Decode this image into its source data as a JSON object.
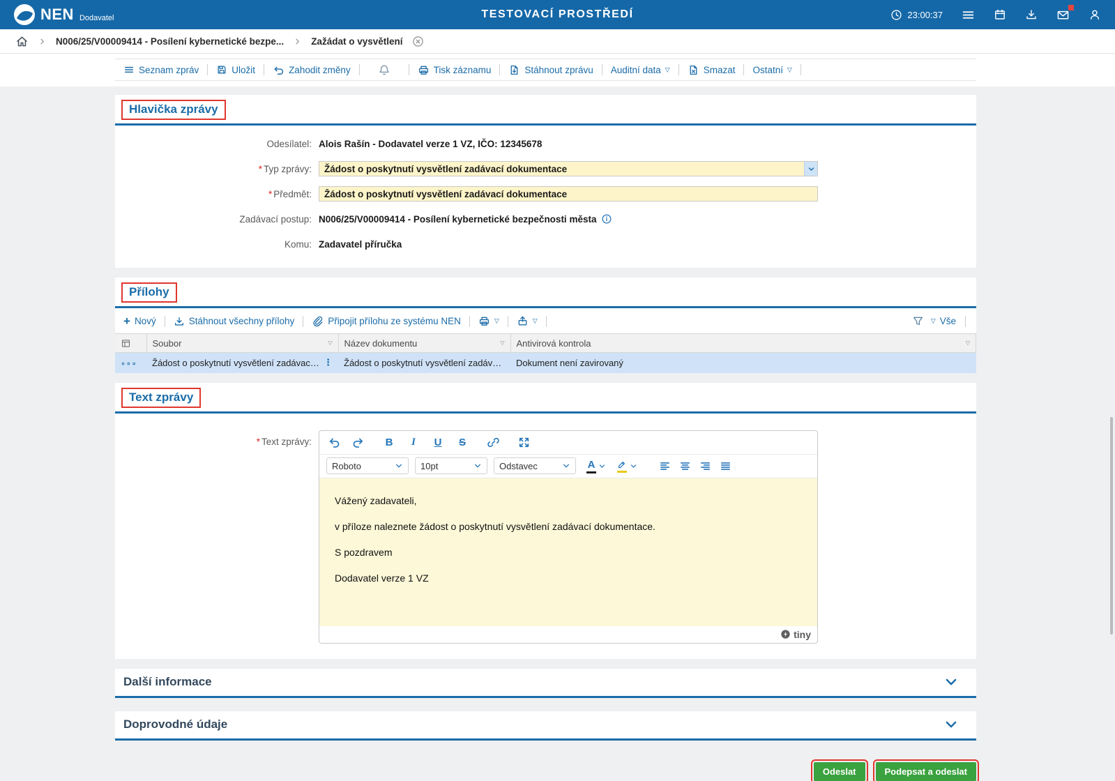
{
  "colors": {
    "header_blue": "#1568a8",
    "accent_blue": "#1b6ca8",
    "field_yellow": "#fdf5c9",
    "selected_row_blue": "#cfe2f7",
    "button_green": "#3aa23e",
    "annotation_red": "#e0372e"
  },
  "icons": {
    "triangle_down": "▽",
    "plus": "+",
    "row_menu": "∘∘∘",
    "drag_dots": "⋮"
  },
  "misc": {
    "required": "*"
  },
  "header": {
    "logo": "NEN",
    "logo_sub": "Dodavatel",
    "title": "TESTOVACÍ PROSTŘEDÍ",
    "time": "23:00:37"
  },
  "breadcrumb": {
    "procedure": "N006/25/V00009414 - Posílení kybernetické bezpe...",
    "current": "Zažádat o vysvětlení"
  },
  "toolbar": {
    "list": "Seznam zpráv",
    "save": "Uložit",
    "discard": "Zahodit změny",
    "print": "Tisk záznamu",
    "download": "Stáhnout zprávu",
    "audit": "Auditní data",
    "delete": "Smazat",
    "other": "Ostatní"
  },
  "message_header": {
    "title": "Hlavička zprávy",
    "sender_label": "Odesílatel:",
    "sender_value": "Alois Rašín - Dodavatel verze 1 VZ, IČO: 12345678",
    "type_label": "Typ zprávy:",
    "type_value": "Žádost o poskytnutí vysvětlení zadávací dokumentace",
    "subject_label": "Předmět:",
    "subject_value": "Žádost o poskytnutí vysvětlení zadávací dokumentace",
    "procedure_label": "Zadávací postup:",
    "procedure_value": "N006/25/V00009414 - Posílení kybernetické bezpečnosti města",
    "to_label": "Komu:",
    "to_value": "Zadavatel příručka"
  },
  "attachments": {
    "title": "Přílohy",
    "new": "Nový",
    "download_all": "Stáhnout všechny přílohy",
    "attach_nen": "Připojit přílohu ze systému NEN",
    "all": "Vše",
    "headers": [
      "Soubor",
      "Název dokumentu",
      "Antivirová kontrola"
    ],
    "rows": [
      {
        "file": "Žádost o poskytnutí vysvětlení zadávací ...",
        "name": "Žádost o poskytnutí vysvětlení zadáva...",
        "antivirus": "Dokument není zavirovaný"
      }
    ]
  },
  "message_text": {
    "title": "Text zprávy",
    "label": "Text zprávy:",
    "font": "Roboto",
    "size": "10pt",
    "block": "Odstavec",
    "bold": "B",
    "italic": "I",
    "underline": "U",
    "strike": "S",
    "color_letter": "A",
    "lines": [
      "Vážený zadavateli,",
      "v příloze naleznete žádost o poskytnutí vysvětlení zadávací dokumentace.",
      "S pozdravem",
      "Dodavatel verze 1 VZ"
    ],
    "tiny": "tiny"
  },
  "sections": {
    "more_info": "Další informace",
    "accompanying": "Doprovodné údaje"
  },
  "actions": {
    "send": "Odeslat",
    "sign_send": "Podepsat a odeslat"
  }
}
